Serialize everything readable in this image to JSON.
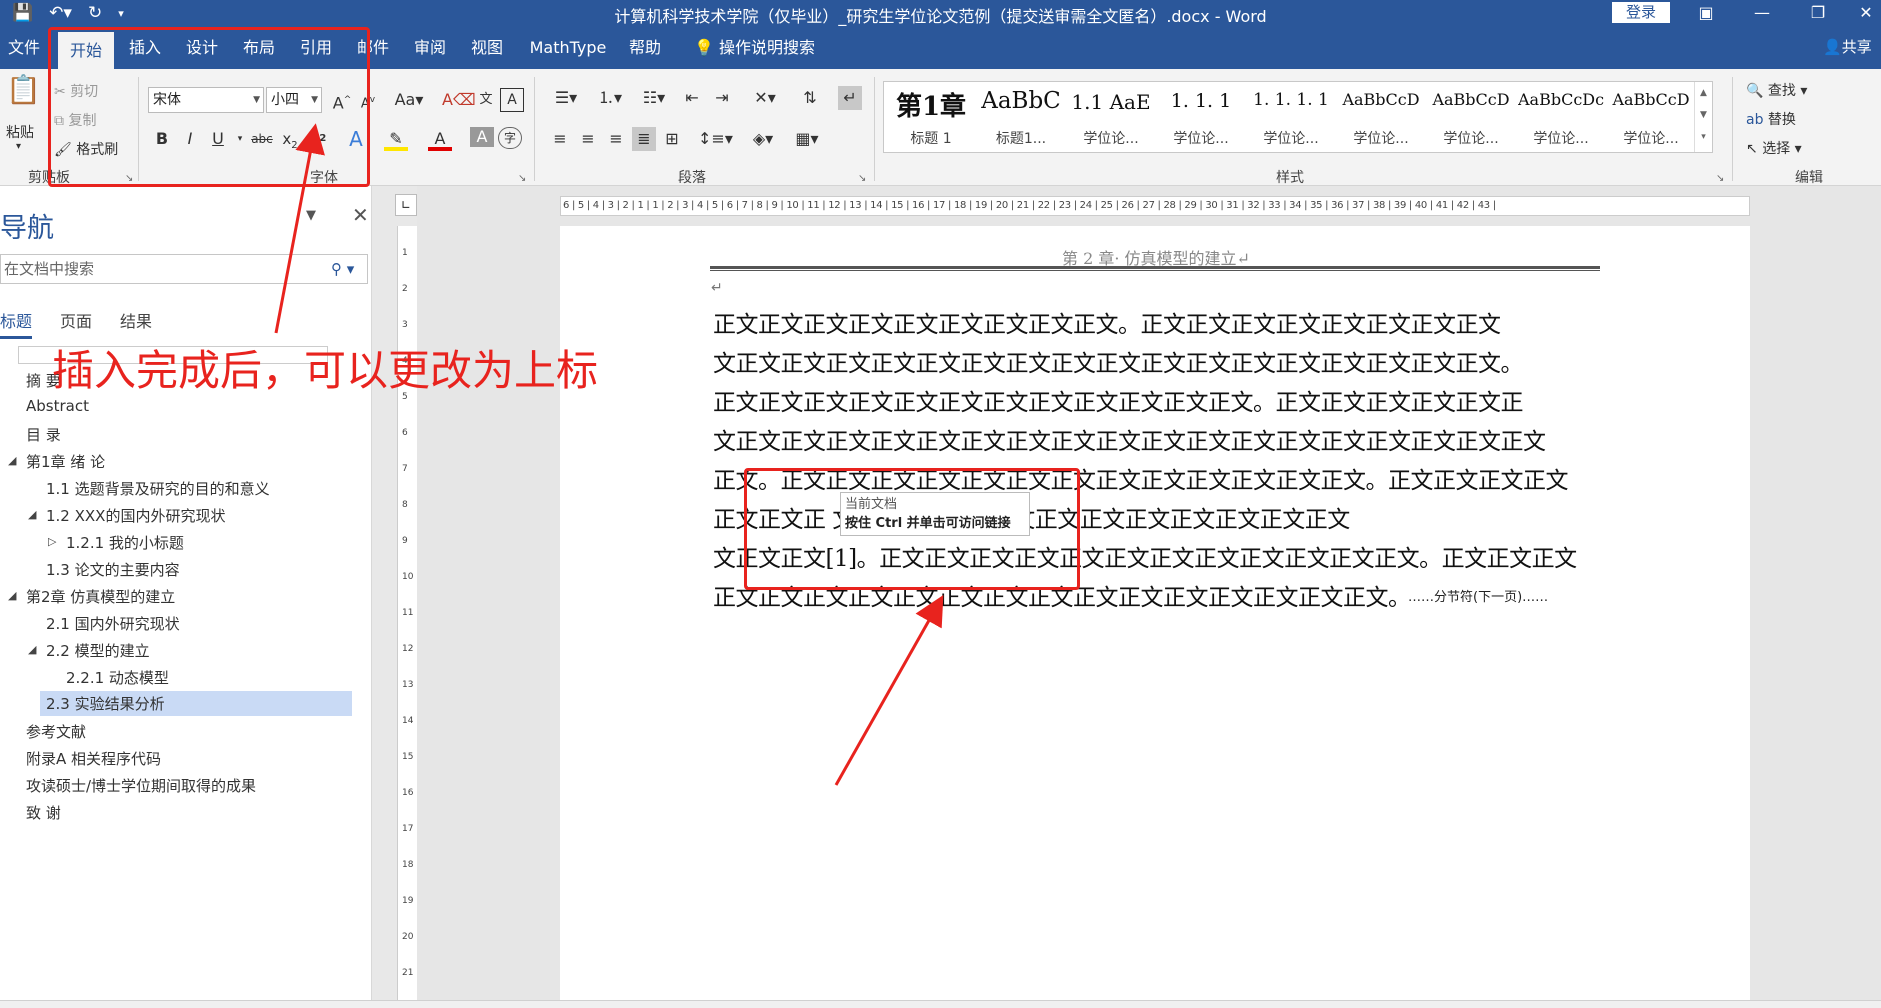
{
  "window": {
    "title": "计算机科学技术学院（仅毕业）_研究生学位论文范例（提交送审需全文匿名）.docx - Word",
    "login_label": "登录"
  },
  "tabs": [
    {
      "label": "文件"
    },
    {
      "label": "开始",
      "active": true
    },
    {
      "label": "插入"
    },
    {
      "label": "设计"
    },
    {
      "label": "布局"
    },
    {
      "label": "引用"
    },
    {
      "label": "邮件"
    },
    {
      "label": "审阅"
    },
    {
      "label": "视图"
    },
    {
      "label": "MathType"
    },
    {
      "label": "帮助"
    }
  ],
  "tell_me": "操作说明搜索",
  "share": "共享",
  "ribbon": {
    "clipboard": {
      "paste": "粘贴",
      "cut": "剪切",
      "copy": "复制",
      "format_painter": "格式刷",
      "label": "剪贴板"
    },
    "font": {
      "font_name": "宋体",
      "font_size": "小四",
      "label": "字体"
    },
    "paragraph": {
      "label": "段落"
    },
    "styles": {
      "label": "样式",
      "items": [
        {
          "preview": "第1章",
          "name": "标题 1"
        },
        {
          "preview": "AaBbC",
          "name": "标题1..."
        },
        {
          "preview": "1.1  AaE",
          "name": "学位论..."
        },
        {
          "preview": "1. 1. 1",
          "name": "学位论..."
        },
        {
          "preview": "1. 1. 1. 1",
          "name": "学位论..."
        },
        {
          "preview": "AaBbCcD",
          "name": "学位论..."
        },
        {
          "preview": "AaBbCcD",
          "name": "学位论..."
        },
        {
          "preview": "AaBbCcDc",
          "name": "学位论..."
        },
        {
          "preview": "AaBbCcD",
          "name": "学位论..."
        }
      ]
    },
    "editing": {
      "find": "查找",
      "replace": "替换",
      "select": "选择",
      "label": "编辑"
    }
  },
  "nav": {
    "title": "导航",
    "search_placeholder": "在文档中搜索",
    "tabs": [
      "标题",
      "页面",
      "结果"
    ],
    "items": [
      {
        "text": "摘  要"
      },
      {
        "text": "Abstract"
      },
      {
        "text": "目  录"
      },
      {
        "text": "第1章 绪  论"
      },
      {
        "text": "1.1 选题背景及研究的目的和意义"
      },
      {
        "text": "1.2 XXX的国内外研究现状"
      },
      {
        "text": "1.2.1 我的小标题"
      },
      {
        "text": "1.3 论文的主要内容"
      },
      {
        "text": "第2章 仿真模型的建立"
      },
      {
        "text": "2.1 国内外研究现状"
      },
      {
        "text": "2.2 模型的建立"
      },
      {
        "text": "2.2.1 动态模型"
      },
      {
        "text": "2.3 实验结果分析"
      },
      {
        "text": "参考文献"
      },
      {
        "text": "附录A 相关程序代码"
      },
      {
        "text": "攻读硕士/博士学位期间取得的成果"
      },
      {
        "text": "致  谢"
      }
    ]
  },
  "document": {
    "header": "第 2 章· 仿真模型的建立↵",
    "lines": [
      "正文正文正文正文正文正文正文正文正文。正文正文正文正文正文正文正文正文",
      "文正文正文正文正文正文正文正文正文正文正文正文正文正文正文正文正文正文。",
      "正文正文正文正文正文正文正文正文正文正文正文正文。正文正文正文正文正文正",
      "文正文正文正文正文正文正文正文正文正文正文正文正文正文正文正文正文正文正文",
      "正文。正文正文正文正文正文正文正文正文正文正文正文正文正文。正文正文正文正文",
      "正文正文正                   文正文正文正文正文正文正文正文正文正文正文正文",
      "文正文正文[1]。正文正文正文正文正文正文正文正文正文正文正文正文。正文正文正文",
      "正文正文正文正文正文正文正文正文正文正文正文正文正文正文正文。"
    ],
    "tooltip_line1": "当前文档",
    "tooltip_line2": "按住 Ctrl 并单击可访问链接",
    "section_break": "……分节符(下一页)……"
  },
  "annotation": {
    "text": "插入完成后，可以更改为上标",
    "color": "#e8231e"
  },
  "colors": {
    "word_blue": "#2b579a",
    "ribbon_bg": "#f3f3f3"
  }
}
